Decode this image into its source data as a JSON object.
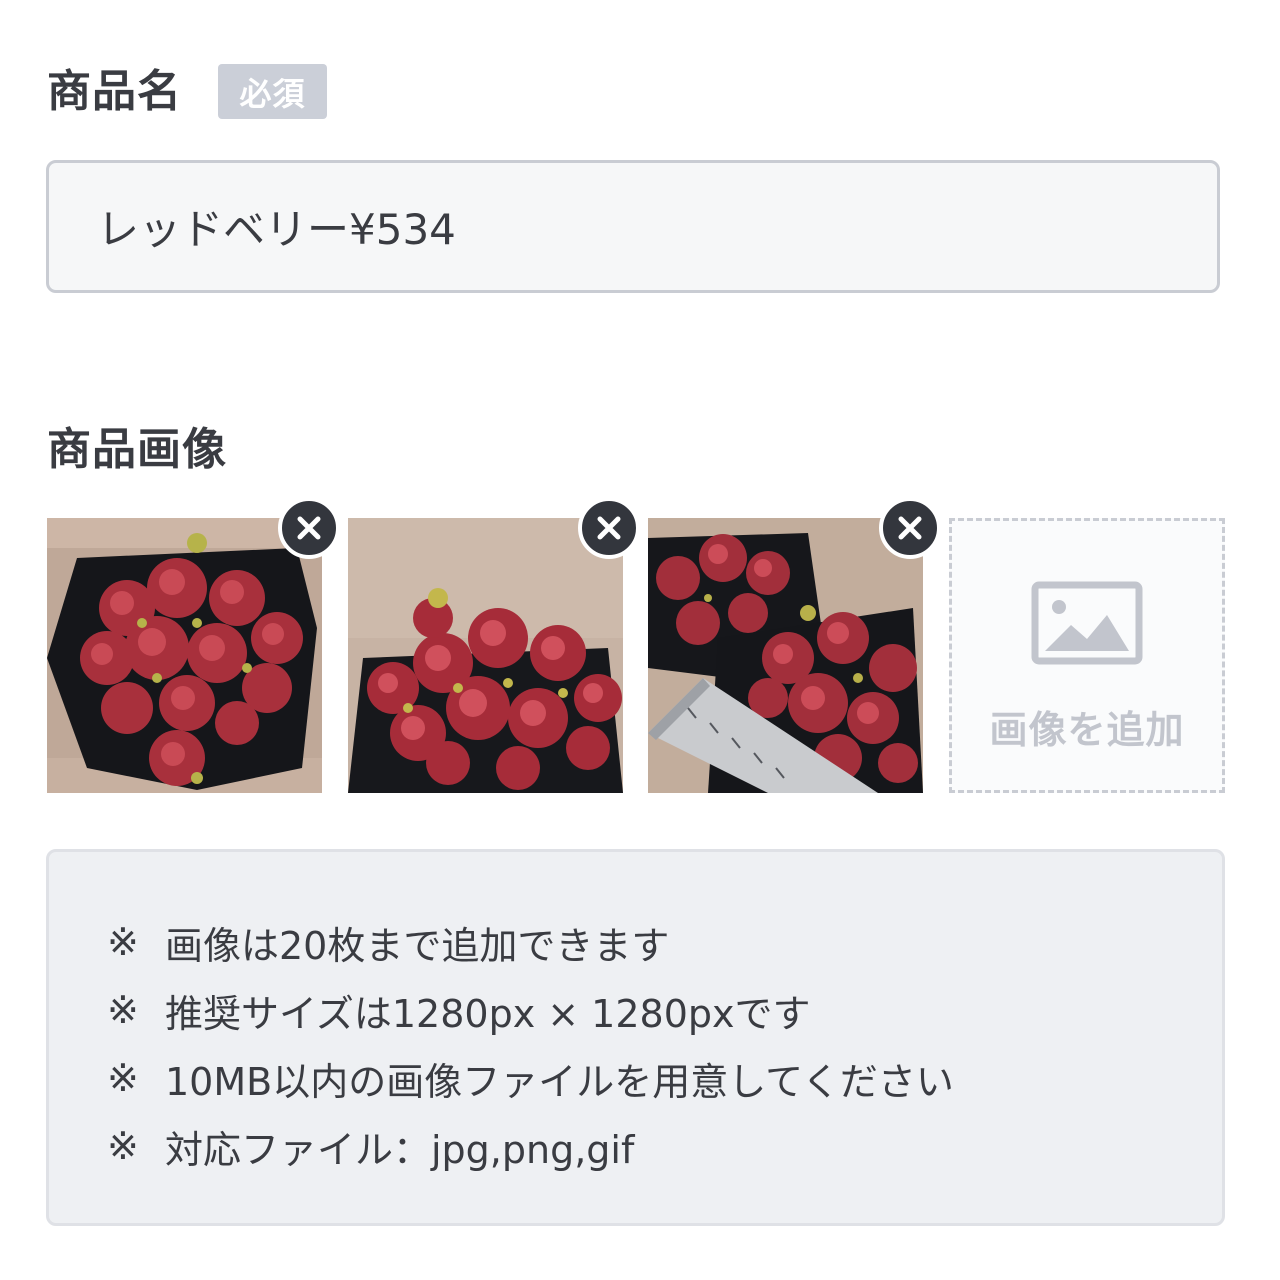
{
  "product_name": {
    "label": "商品名",
    "required_badge": "必須",
    "value": "レッドベリー¥534"
  },
  "product_images": {
    "label": "商品画像",
    "images": [
      {
        "alt": "succulent-photo-1",
        "remove_icon": "close-icon"
      },
      {
        "alt": "succulent-photo-2",
        "remove_icon": "close-icon"
      },
      {
        "alt": "succulent-photo-3",
        "remove_icon": "close-icon"
      }
    ],
    "add_label": "画像を追加",
    "add_icon": "image-placeholder-icon"
  },
  "notes": {
    "mark": "※",
    "items": [
      "画像は20枚まで追加できます",
      "推奨サイズは1280px × 1280pxです",
      "10MB以内の画像ファイルを用意してください",
      "対応ファイル：jpg,png,gif"
    ]
  },
  "colors": {
    "text": "#3a3c42",
    "badge_bg": "#cbcfd8",
    "input_border": "#c9ccd3",
    "notes_bg": "#eef0f3",
    "remove_button": "#33363d"
  }
}
